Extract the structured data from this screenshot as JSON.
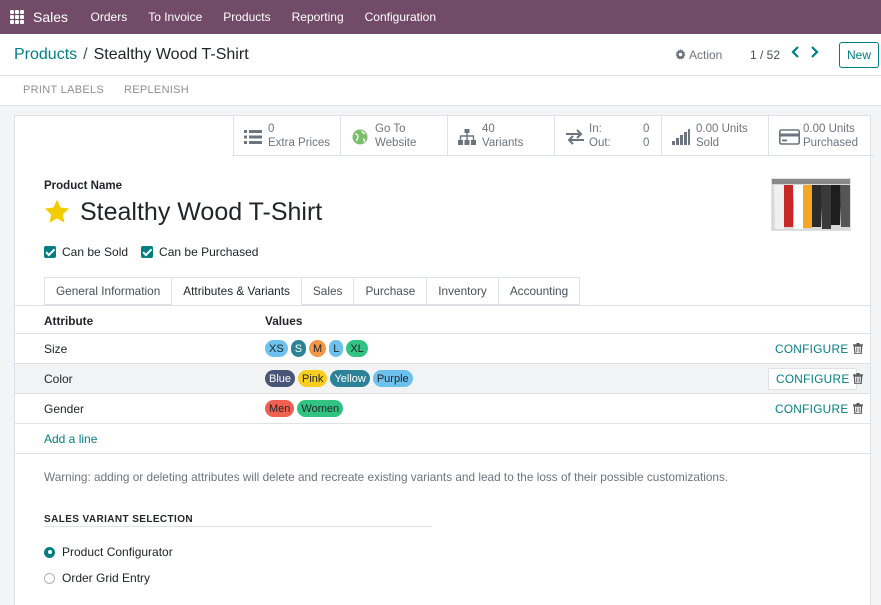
{
  "navbar": {
    "app_name": "Sales",
    "menu": [
      "Orders",
      "To Invoice",
      "Products",
      "Reporting",
      "Configuration"
    ]
  },
  "control_panel": {
    "breadcrumb_parent": "Products",
    "breadcrumb_separator": "/",
    "breadcrumb_current": "Stealthy Wood T-Shirt",
    "action_label": "Action",
    "pager": "1 / 52",
    "new_label": "New"
  },
  "status_bar": {
    "print_labels": "PRINT LABELS",
    "replenish": "REPLENISH"
  },
  "smart_buttons": {
    "extra_prices": {
      "value": "0",
      "label": "Extra Prices",
      "icon": "list-icon"
    },
    "website": {
      "value": "Go To",
      "label": "Website",
      "icon": "globe-icon"
    },
    "variants": {
      "value": "40",
      "label": "Variants",
      "icon": "sitemap-icon"
    },
    "in_out": {
      "in_label": "In:",
      "in_value": "0",
      "out_label": "Out:",
      "out_value": "0",
      "icon": "exchange-icon"
    },
    "sold": {
      "value": "0.00 Units",
      "label": "Sold",
      "icon": "signal-icon"
    },
    "purchased": {
      "value": "0.00 Units",
      "label": "Purchased",
      "icon": "credit-card-icon"
    }
  },
  "product": {
    "name_label": "Product Name",
    "name": "Stealthy Wood T-Shirt",
    "can_be_sold": "Can be Sold",
    "can_be_purchased": "Can be Purchased"
  },
  "tabs": [
    {
      "label": "General Information",
      "active": false
    },
    {
      "label": "Attributes & Variants",
      "active": true
    },
    {
      "label": "Sales",
      "active": false
    },
    {
      "label": "Purchase",
      "active": false
    },
    {
      "label": "Inventory",
      "active": false
    },
    {
      "label": "Accounting",
      "active": false
    }
  ],
  "attributes_table": {
    "headers": {
      "attribute": "Attribute",
      "values": "Values"
    },
    "configure_label": "CONFIGURE",
    "rows": [
      {
        "attribute": "Size",
        "values": [
          {
            "label": "XS",
            "bg": "#6cc1ed",
            "fg": "#212529"
          },
          {
            "label": "S",
            "bg": "#2c8397",
            "fg": "#ffffff"
          },
          {
            "label": "M",
            "bg": "#f29648",
            "fg": "#212529"
          },
          {
            "label": "L",
            "bg": "#6cc1ed",
            "fg": "#212529"
          },
          {
            "label": "XL",
            "bg": "#30c381",
            "fg": "#212529"
          }
        ]
      },
      {
        "attribute": "Color",
        "values": [
          {
            "label": "Blue",
            "bg": "#475577",
            "fg": "#ffffff"
          },
          {
            "label": "Pink",
            "bg": "#f7cd1f",
            "fg": "#212529"
          },
          {
            "label": "Yellow",
            "bg": "#2c8397",
            "fg": "#ffffff"
          },
          {
            "label": "Purple",
            "bg": "#6cc1ed",
            "fg": "#212529"
          }
        ]
      },
      {
        "attribute": "Gender",
        "values": [
          {
            "label": "Men",
            "bg": "#f06050",
            "fg": "#212529"
          },
          {
            "label": "Women",
            "bg": "#30c381",
            "fg": "#212529"
          }
        ]
      }
    ],
    "add_line": "Add a line"
  },
  "warning": "Warning: adding or deleting attributes will delete and recreate existing variants and lead to the loss of their possible customizations.",
  "sales_variant": {
    "title": "SALES VARIANT SELECTION",
    "options": [
      {
        "label": "Product Configurator",
        "selected": true
      },
      {
        "label": "Order Grid Entry",
        "selected": false
      }
    ]
  },
  "colors": {
    "primary": "#714B67",
    "accent": "#017e84",
    "star": "#f3cc00"
  }
}
